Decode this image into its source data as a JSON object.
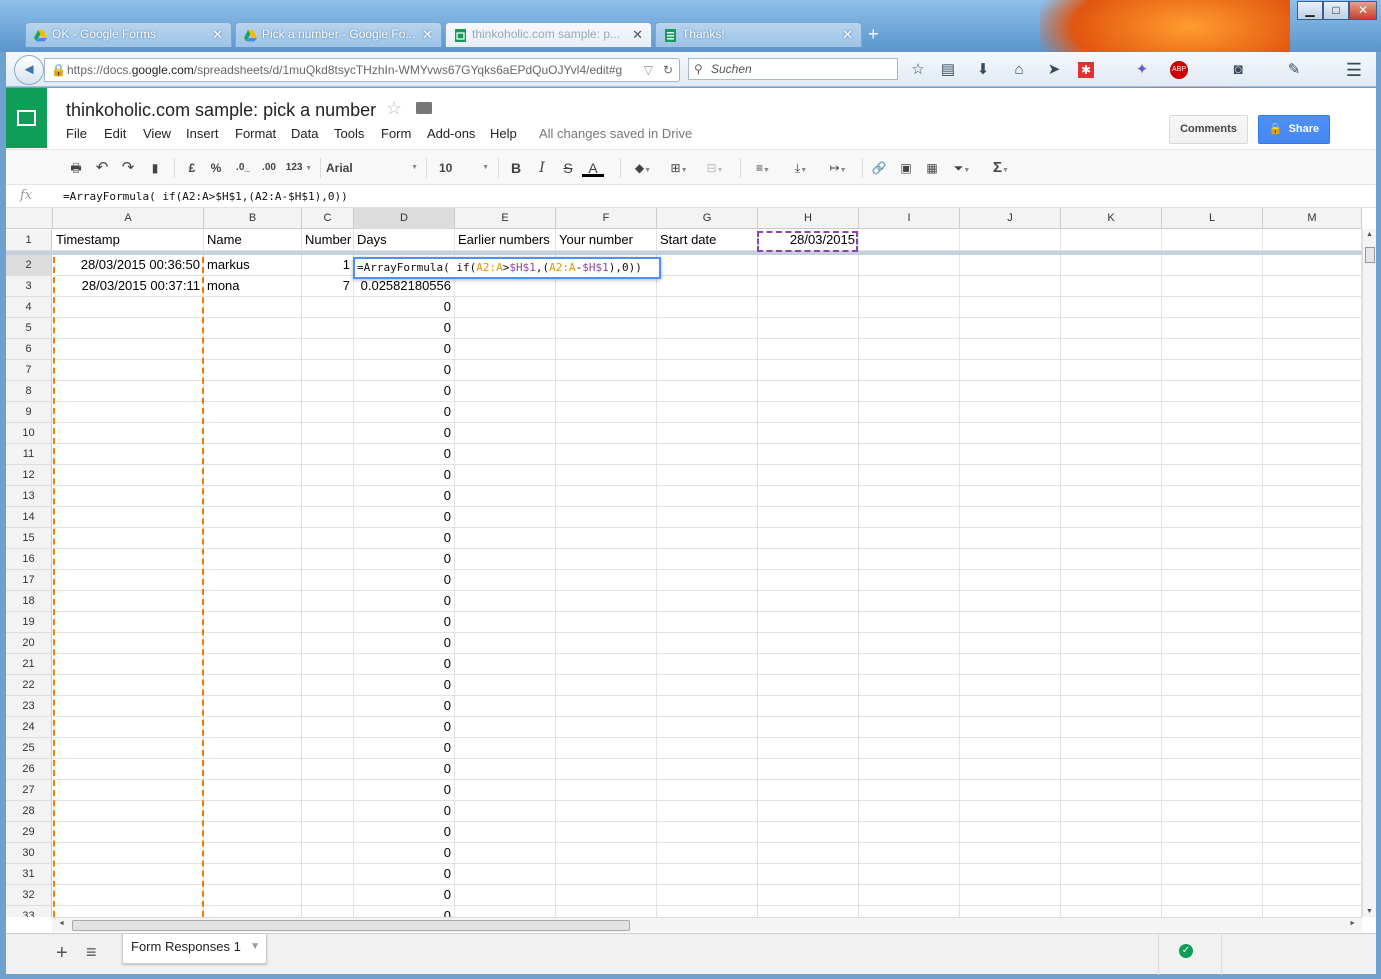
{
  "browser": {
    "tabs": [
      {
        "label": "OK - Google Forms",
        "icon": "google-drive-icon"
      },
      {
        "label": "Pick a number - Google Fo...",
        "icon": "google-drive-icon"
      },
      {
        "label": "thinkoholic.com sample: p...",
        "icon": "sheets-icon"
      },
      {
        "label": "Thanks!",
        "icon": "forms-icon"
      }
    ],
    "new_tab": "+",
    "url_prefix": "https://docs.",
    "url_domain": "google.com",
    "url_rest": "/spreadsheets/d/1muQkd8tsycTHzhIn-WMYvws67GYqks6aEPdQuOJYvl4/edit#g",
    "search_placeholder": "Suchen",
    "window_buttons": {
      "minimize": "▁",
      "maximize": "□",
      "close": "✕"
    },
    "back": "◄"
  },
  "app": {
    "title": "thinkoholic.com sample: pick a number",
    "menus": [
      "File",
      "Edit",
      "View",
      "Insert",
      "Format",
      "Data",
      "Tools",
      "Form",
      "Add-ons",
      "Help"
    ],
    "save_status": "All changes saved in Drive",
    "comments_label": "Comments",
    "share_label": "Share"
  },
  "toolbar": {
    "currency": "£",
    "percent": "%",
    "dec_decrease": ".0_",
    "dec_increase": ".00",
    "more_formats": "123",
    "font": "Arial",
    "font_size": "10",
    "bold": "B",
    "italic": "I",
    "strike": "S",
    "text_color": "A",
    "sum": "Σ"
  },
  "formula_bar": {
    "fx_label": "fx",
    "formula": "=ArrayFormula( if(A2:A>$H$1,(A2:A-$H$1),0))"
  },
  "editor": {
    "p1": "=ArrayFormula( if(",
    "ref1": "A2:A",
    "p2": ">",
    "ref2": "$H$1",
    "p3": ",(",
    "ref3": "A2:A",
    "p4": "-",
    "ref4": "$H$1",
    "p5": "),0))"
  },
  "sheet": {
    "columns": [
      "A",
      "B",
      "C",
      "D",
      "E",
      "F",
      "G",
      "H",
      "I",
      "J",
      "K",
      "L",
      "M"
    ],
    "row1": [
      "Timestamp",
      "Name",
      "Number",
      "Days",
      "Earlier numbers",
      "Your number",
      "Start date",
      "28/03/2015"
    ],
    "row2": [
      "28/03/2015 00:36:50",
      "markus",
      "1"
    ],
    "row3": [
      "28/03/2015 00:37:11",
      "mona",
      "7",
      "0.02582180556"
    ],
    "rows": [
      "1",
      "2",
      "3",
      "4",
      "5",
      "6",
      "7",
      "8",
      "9",
      "10",
      "11",
      "12",
      "13",
      "14",
      "15",
      "16",
      "17",
      "18",
      "19",
      "20",
      "21",
      "22",
      "23",
      "24",
      "25",
      "26",
      "27",
      "28",
      "29",
      "30",
      "31",
      "32",
      "33"
    ],
    "zero_value": "0"
  },
  "bottom": {
    "sheet_tab": "Form Responses 1",
    "add_sheet": "+",
    "all_sheets": "≡",
    "saved_check": "✓"
  }
}
